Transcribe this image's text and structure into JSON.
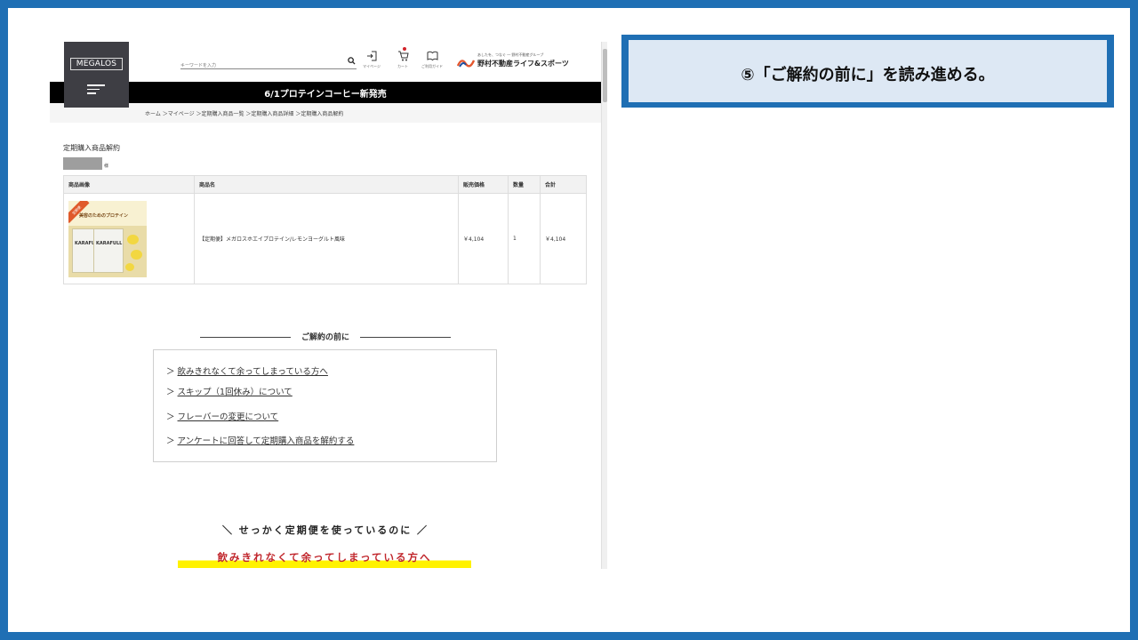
{
  "instruction": {
    "text": "⑤「ご解約の前に」を読み進める。"
  },
  "site": {
    "logo": "MEGALOS",
    "search_placeholder": "キーワードを入力",
    "header_icons": [
      {
        "name": "mypage",
        "label": "マイページ"
      },
      {
        "name": "cart",
        "label": "カート"
      },
      {
        "name": "guide",
        "label": "ご利用ガイド"
      }
    ],
    "brand_tagline": "あしたを、つなぐ ― 野村不動産グループ",
    "brand_name": "野村不動産ライフ&スポーツ",
    "banner": "6/1プロテインコーヒー新発売",
    "breadcrumb": "ホーム ＞マイページ ＞定期購入商品一覧 ＞定期購入商品詳細 ＞定期購入商品解約"
  },
  "page": {
    "title": "定期購入商品解約",
    "name_suffix": "様",
    "table": {
      "headers": [
        "商品画像",
        "商品名",
        "販売価格",
        "数量",
        "合計"
      ],
      "row": {
        "image_ribbon": "定期便",
        "image_title": "美容のためのプロテイン",
        "image_pack_label": "KARAFULL",
        "name": "【定期便】メガロスホエイプロテイン/レモンヨーグルト風味",
        "price": "￥4,104",
        "qty": "1",
        "total": "￥4,104"
      }
    },
    "section_title": "ご解約の前に",
    "links": [
      "飲みきれなくて余ってしまっている方へ",
      "スキップ（1回休み）について",
      "フレーバーの変更について",
      "アンケートに回答して定期購入商品を解約する"
    ],
    "link_prefix": "＞",
    "promo_line1": "＼ せっかく定期便を使っているのに ／",
    "promo_line2": "飲みきれなくて余ってしまっている方へ"
  },
  "colors": {
    "frame": "#1f6fb4",
    "callout_bg": "#dde8f4",
    "promo_red": "#c1272d",
    "promo_highlight": "#fff200"
  }
}
